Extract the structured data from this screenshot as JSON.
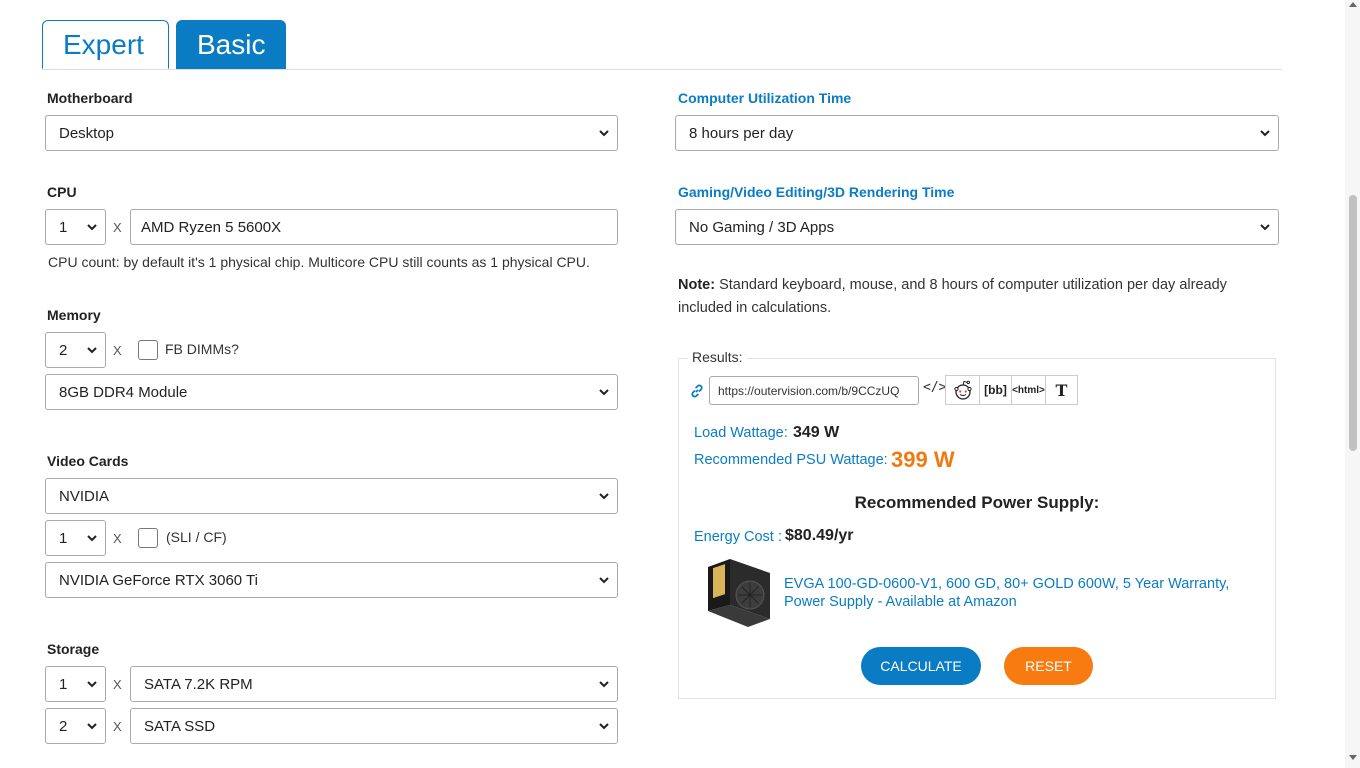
{
  "tabs": {
    "expert": "Expert",
    "basic": "Basic"
  },
  "motherboard": {
    "label": "Motherboard",
    "value": "Desktop"
  },
  "cpu": {
    "label": "CPU",
    "count": "1",
    "x": "X",
    "model": "AMD Ryzen 5 5600X",
    "help": "CPU count: by default it's 1 physical chip. Multicore CPU still counts as 1 physical CPU."
  },
  "memory": {
    "label": "Memory",
    "count": "2",
    "x": "X",
    "fb_dimms_label": "FB DIMMs?",
    "module": "8GB DDR4 Module"
  },
  "video": {
    "label": "Video Cards",
    "brand": "NVIDIA",
    "count": "1",
    "x": "X",
    "sli_label": "(SLI / CF)",
    "model": "NVIDIA GeForce RTX 3060 Ti"
  },
  "storage": {
    "label": "Storage",
    "rows": [
      {
        "count": "1",
        "x": "X",
        "type": "SATA 7.2K RPM"
      },
      {
        "count": "2",
        "x": "X",
        "type": "SATA SSD"
      }
    ]
  },
  "utilization": {
    "label": "Computer Utilization Time",
    "value": "8 hours per day"
  },
  "gaming": {
    "label": "Gaming/Video Editing/3D Rendering Time",
    "value": "No Gaming / 3D Apps"
  },
  "note": {
    "bold": "Note:",
    "text": " Standard keyboard, mouse, and 8 hours of computer utilization per day already included in calculations."
  },
  "results": {
    "legend": "Results:",
    "url": "https://outervision.com/b/9CCzUQ",
    "embed": "</>",
    "share": {
      "bb": "[bb]",
      "html": "<html>",
      "text": "T"
    },
    "load_wattage_label": "Load Wattage:",
    "load_wattage_value": "349 W",
    "psu_wattage_label": "Recommended PSU Wattage:",
    "psu_wattage_value": "399 W",
    "rec_title": "Recommended Power Supply:",
    "energy_cost_label": "Energy Cost :",
    "energy_cost_value": "$80.49/yr",
    "psu_link": "EVGA 100-GD-0600-V1, 600 GD, 80+ GOLD 600W, 5 Year Warranty, Power Supply - Available at Amazon",
    "calculate": "CALCULATE",
    "reset": "RESET"
  },
  "colors": {
    "accent": "#0a7cc4",
    "orange": "#f77b10"
  }
}
